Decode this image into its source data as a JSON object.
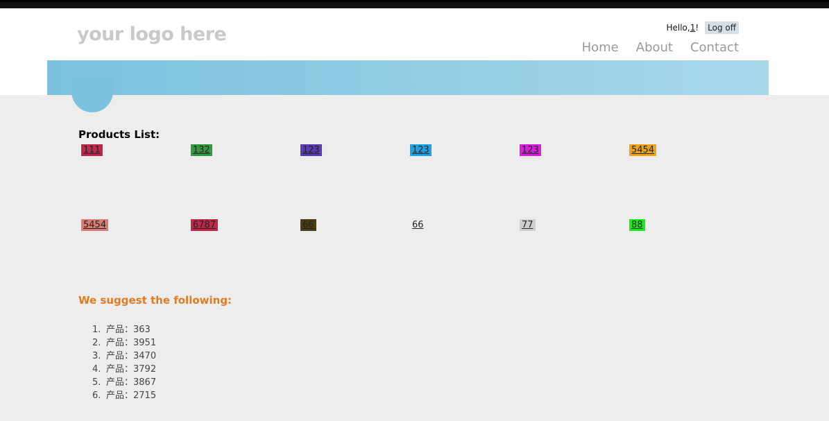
{
  "header": {
    "logo": "your logo here",
    "greeting": "Hello, ",
    "username": "1",
    "greeting_end": "!",
    "logoff": "Log off",
    "nav": [
      "Home",
      "About",
      "Contact"
    ]
  },
  "products": {
    "title": "Products List:",
    "items": [
      {
        "label": "111",
        "color": "#c1274a"
      },
      {
        "label": "132",
        "color": "#2f9d3f"
      },
      {
        "label": "123",
        "color": "#5a3ab5"
      },
      {
        "label": "123",
        "color": "#1aa3e8"
      },
      {
        "label": "123",
        "color": "#dc1be0"
      },
      {
        "label": "5454",
        "color": "#f0a516"
      },
      {
        "label": "5454",
        "color": "#dc7b72"
      },
      {
        "label": "6787",
        "color": "#c2254a"
      },
      {
        "label": "66",
        "color": "#4a3d12"
      },
      {
        "label": "66",
        "color": ""
      },
      {
        "label": "77",
        "color": "#cfcfcf"
      },
      {
        "label": "88",
        "color": "#14ee14"
      }
    ]
  },
  "suggest": {
    "title": "We suggest the following:",
    "items": [
      "产品：363",
      "产品：3951",
      "产品：3470",
      "产品：3792",
      "产品：3867",
      "产品：2715"
    ]
  }
}
